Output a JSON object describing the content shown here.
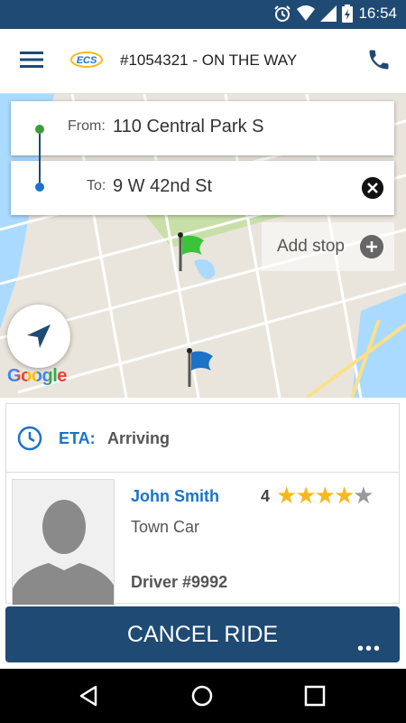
{
  "status_bar": {
    "time": "16:54"
  },
  "app_bar": {
    "title": "#1054321 - ON THE WAY",
    "logo_text": "ECS"
  },
  "addresses": {
    "from_label": "From:",
    "from_value": "110 Central Park S",
    "to_label": "To:",
    "to_value": "9 W 42nd St",
    "add_stop": "Add stop"
  },
  "map": {
    "attribution": "Google"
  },
  "eta": {
    "label": "ETA:",
    "value": "Arriving"
  },
  "driver": {
    "name": "John Smith",
    "vehicle": "Town Car",
    "number": "Driver #9992",
    "rating": "4",
    "stars_filled": 4,
    "stars_total": 5
  },
  "actions": {
    "cancel_label": "CANCEL RIDE",
    "more_label": "•••"
  },
  "colors": {
    "primary": "#1f4a73",
    "accent": "#1a72c9",
    "star": "#f6b91b"
  }
}
